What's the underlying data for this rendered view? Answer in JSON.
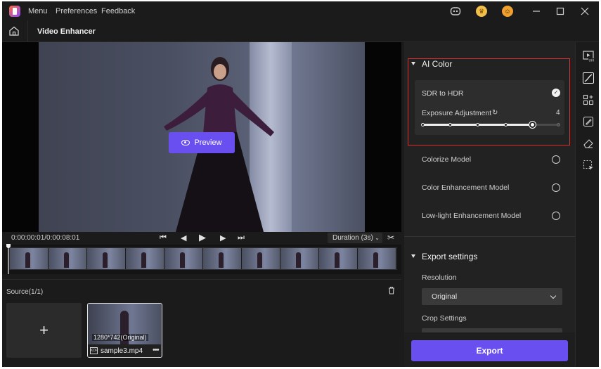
{
  "titlebar": {
    "menu": "Menu",
    "preferences": "Preferences",
    "feedback": "Feedback"
  },
  "header": {
    "title": "Video Enhancer"
  },
  "video": {
    "preview_label": "Preview"
  },
  "timeline": {
    "timecode": "0:00:00:01/0:00:08:01",
    "duration": "Duration (3s)"
  },
  "source": {
    "label": "Source(1/1)",
    "add_label": "+",
    "files": [
      {
        "name": "sample3.mp4",
        "resolution": "1280*742(Original)",
        "format_icon": "KDR"
      }
    ]
  },
  "panel": {
    "ai_color": {
      "title": "AI Color",
      "sdr_to_hdr": "SDR to HDR",
      "exposure_label": "Exposure Adjustment",
      "exposure_value": "4",
      "exposure_level": 4,
      "exposure_max": 5
    },
    "models": [
      "Colorize Model",
      "Color Enhancement Model",
      "Low-light Enhancement Model"
    ],
    "export_settings": {
      "title": "Export settings",
      "resolution_label": "Resolution",
      "resolution_value": "Original",
      "crop_label": "Crop Settings"
    },
    "export_button": "Export"
  },
  "colors": {
    "accent": "#6a4ff0",
    "highlight_box": "#e02d2d",
    "background": "#1b1b1b"
  },
  "icons": [
    "app-logo-icon",
    "discord-icon",
    "coin-icon",
    "user-avatar-icon",
    "minimize-icon",
    "maximize-icon",
    "close-icon",
    "home-icon",
    "eye-icon",
    "skip-back-icon",
    "step-back-icon",
    "play-icon",
    "step-forward-icon",
    "skip-forward-icon",
    "scissors-icon",
    "trash-icon",
    "check-icon",
    "refresh-icon",
    "uhd-video-icon",
    "color-curve-icon",
    "ai-object-icon",
    "edit-icon",
    "eraser-icon",
    "selection-icon"
  ]
}
